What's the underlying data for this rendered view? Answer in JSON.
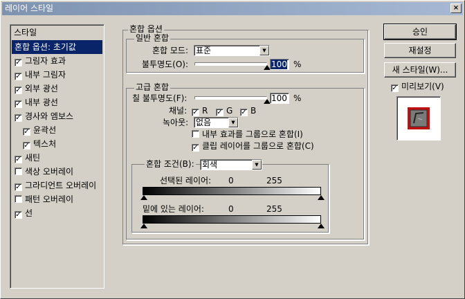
{
  "window": {
    "title": "레이어 스타일",
    "close_label": "×"
  },
  "sidebar": {
    "header": "스타일",
    "items": [
      {
        "label": "혼합 옵션: 초기값",
        "checkbox": false,
        "checked": false,
        "selected": true,
        "sub": false
      },
      {
        "label": "그림자 효과",
        "checkbox": true,
        "checked": true,
        "selected": false,
        "sub": false
      },
      {
        "label": "내부 그림자",
        "checkbox": true,
        "checked": true,
        "selected": false,
        "sub": false
      },
      {
        "label": "외부 광선",
        "checkbox": true,
        "checked": true,
        "selected": false,
        "sub": false
      },
      {
        "label": "내부 광선",
        "checkbox": true,
        "checked": true,
        "selected": false,
        "sub": false
      },
      {
        "label": "경사와 엠보스",
        "checkbox": true,
        "checked": true,
        "selected": false,
        "sub": false
      },
      {
        "label": "윤곽선",
        "checkbox": true,
        "checked": true,
        "selected": false,
        "sub": true
      },
      {
        "label": "텍스처",
        "checkbox": true,
        "checked": true,
        "selected": false,
        "sub": true
      },
      {
        "label": "새틴",
        "checkbox": true,
        "checked": true,
        "selected": false,
        "sub": false
      },
      {
        "label": "색상 오버레이",
        "checkbox": true,
        "checked": false,
        "selected": false,
        "sub": false
      },
      {
        "label": "그라디언트 오버레이",
        "checkbox": true,
        "checked": true,
        "selected": false,
        "sub": false
      },
      {
        "label": "패턴 오버레이",
        "checkbox": true,
        "checked": false,
        "selected": false,
        "sub": false
      },
      {
        "label": "선",
        "checkbox": true,
        "checked": true,
        "selected": false,
        "sub": false
      }
    ]
  },
  "blend": {
    "title": "혼합 옵션",
    "general": {
      "title": "일반 혼합",
      "mode_label": "혼합 모드:",
      "mode_value": "표준",
      "opacity_label": "불투명도(O):",
      "opacity_value": "100",
      "opacity_unit": "%",
      "opacity_fraction": 1.0
    },
    "advanced": {
      "title": "고급 혼합",
      "fill_label": "칠 불투명도(F):",
      "fill_value": "100",
      "fill_unit": "%",
      "fill_fraction": 1.0,
      "channels_label": "채널:",
      "channels": [
        {
          "label": "R",
          "checked": true
        },
        {
          "label": "G",
          "checked": true
        },
        {
          "label": "B",
          "checked": true
        }
      ],
      "knockout_label": "녹아웃:",
      "knockout_value": "없음",
      "blend_interior": {
        "label": "내부 효과를 그룹으로 혼합(I)",
        "checked": false
      },
      "blend_clipped": {
        "label": "클립 레이어를 그룹으로 혼합(C)",
        "checked": true
      }
    },
    "blend_if": {
      "label": "혼합 조건(B):",
      "value": "회색",
      "this_layer_label": "선택된 레이어:",
      "this_layer_min": "0",
      "this_layer_max": "255",
      "underlying_label": "밑에 있는 레이어:",
      "underlying_min": "0",
      "underlying_max": "255"
    }
  },
  "buttons": {
    "ok": "승인",
    "reset": "재설정",
    "new_style": "새 스타일(W)..."
  },
  "preview": {
    "label": "미리보기(V)",
    "checked": true
  }
}
